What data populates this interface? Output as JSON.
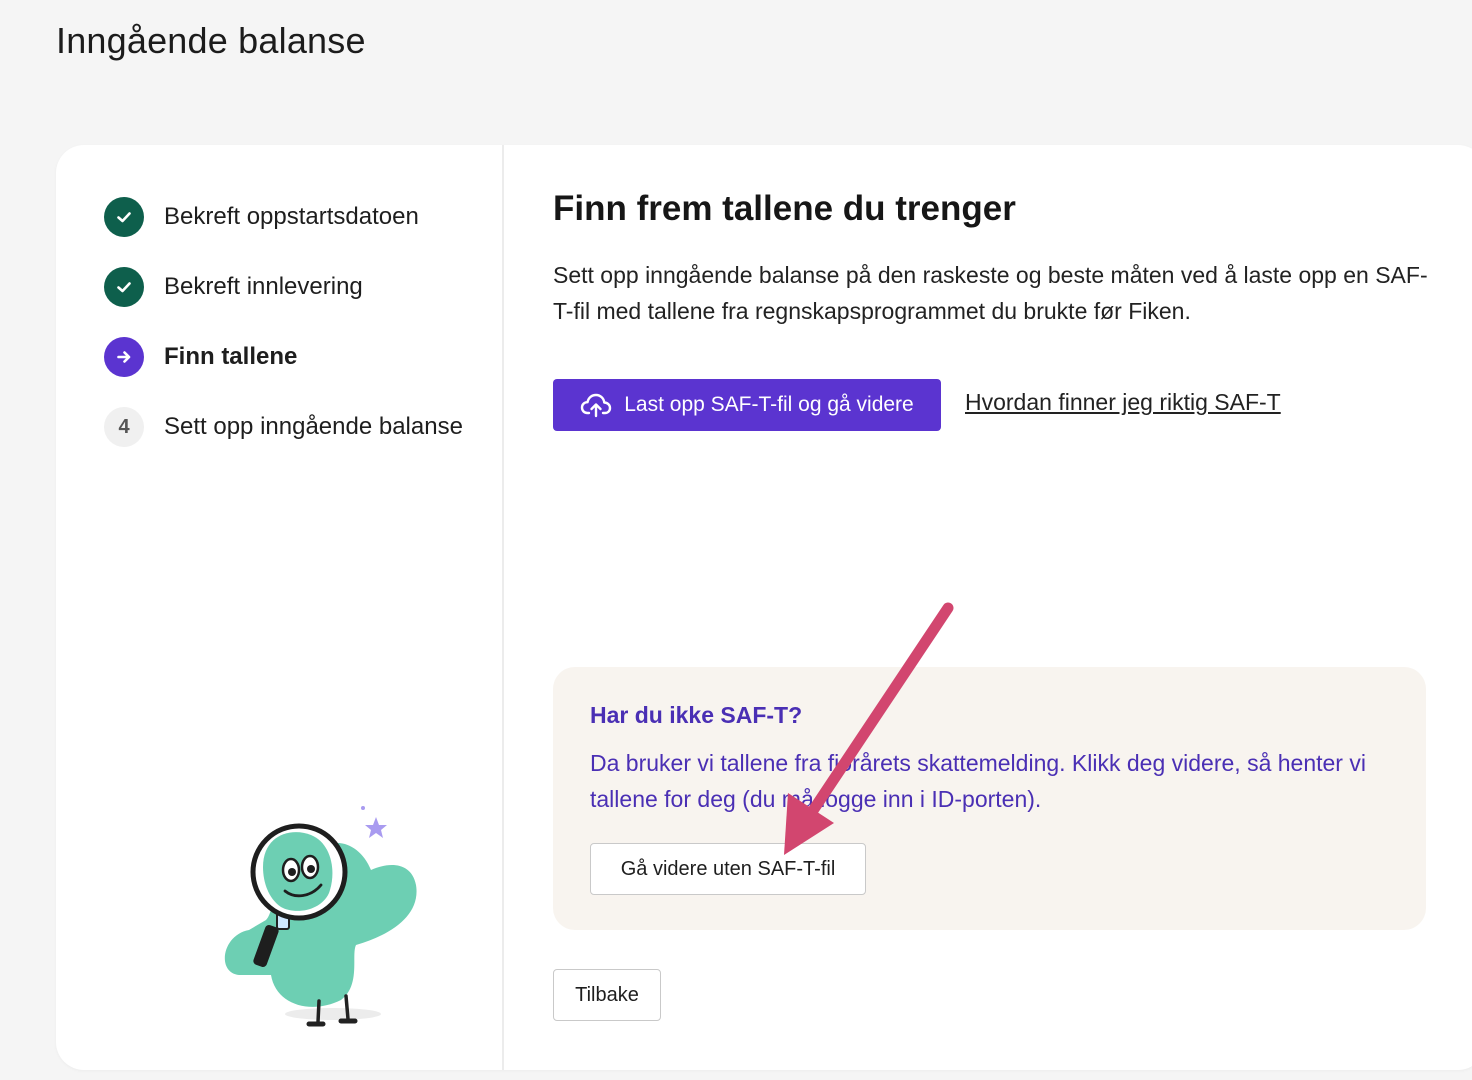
{
  "page": {
    "title": "Inngående balanse"
  },
  "steps": [
    {
      "label": "Bekreft oppstartsdatoen",
      "state": "done",
      "icon": "check-icon"
    },
    {
      "label": "Bekreft innlevering",
      "state": "done",
      "icon": "check-icon"
    },
    {
      "label": "Finn tallene",
      "state": "current",
      "icon": "arrow-right-icon"
    },
    {
      "label": "Sett opp inngående balanse",
      "state": "pending",
      "number": "4"
    }
  ],
  "main": {
    "heading": "Finn frem tallene du trenger",
    "intro": "Sett opp inngående balanse på den raskeste og beste måten ved å laste opp en SAF-T-fil med tallene fra regnskapsprogrammet du brukte før Fiken.",
    "upload_button": "Last opp SAF-T-fil og gå videre",
    "help_link": "Hvordan finner jeg riktig SAF-T"
  },
  "info_box": {
    "title": "Har du ikke SAF-T?",
    "text": "Da bruker vi tallene fra fjorårets skattemelding. Klikk deg videre, så henter vi tallene for deg (du må logge inn i ID-porten).",
    "button": "Gå videre uten SAF-T-fil"
  },
  "footer": {
    "back_button": "Tilbake"
  },
  "colors": {
    "done": "#0e5f4c",
    "current": "#5b34d0",
    "primary": "#5b34d0",
    "info_text": "#4a2fb4",
    "info_bg": "#f8f4ef",
    "annotation_arrow": "#d2466f",
    "mascot": "#6dcfb3"
  }
}
